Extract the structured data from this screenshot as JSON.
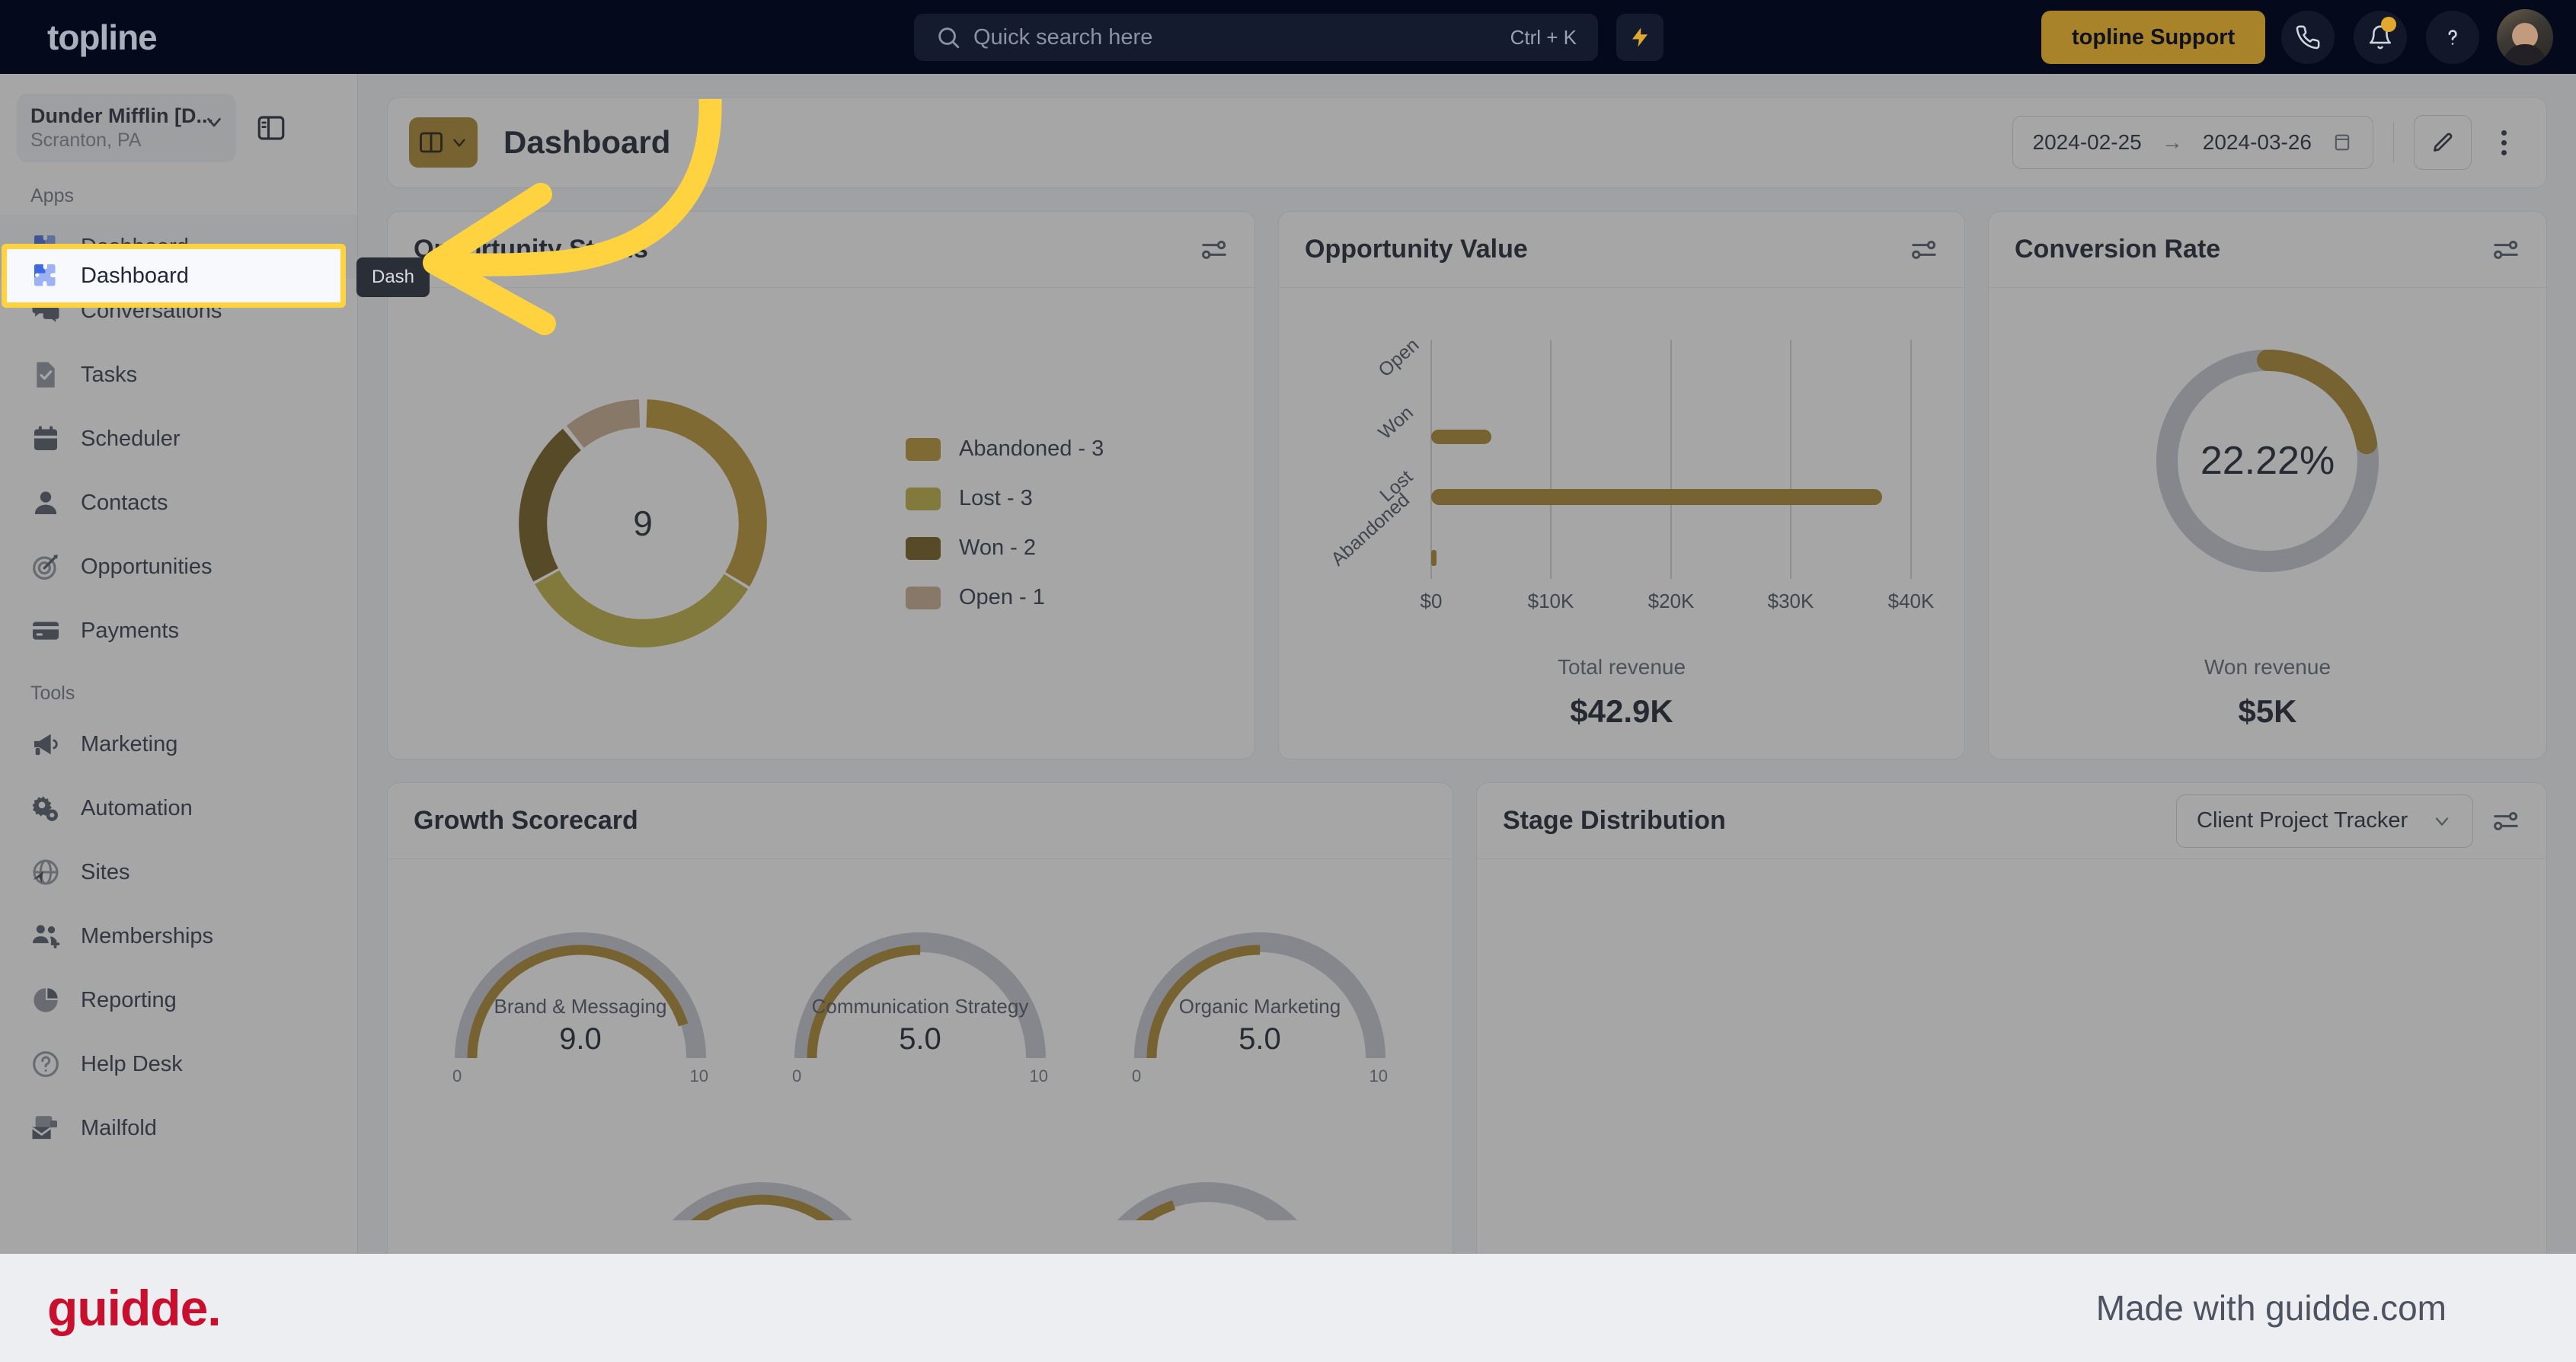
{
  "topbar": {
    "logo": "topline",
    "search": {
      "placeholder": "Quick search here",
      "value": "",
      "shortcut": "Ctrl + K",
      "icon": "search-icon"
    },
    "bolt_icon": "lightning-bolt-icon",
    "support_button": "topline Support",
    "phone_icon": "phone-icon",
    "bell_icon": "bell-icon",
    "help_icon": "question-mark-icon",
    "avatar": "user-avatar"
  },
  "sidebar": {
    "org": {
      "name": "Dunder Mifflin [D...",
      "location": "Scranton, PA",
      "chevron": "chevron-down-icon"
    },
    "panel_toggle_icon": "panel-collapse-icon",
    "sections": [
      {
        "label": "Apps",
        "items": [
          {
            "label": "Dashboard",
            "icon": "puzzle-icon",
            "active": true
          },
          {
            "label": "Conversations",
            "icon": "chat-bubbles-icon",
            "active": false
          },
          {
            "label": "Tasks",
            "icon": "task-check-icon",
            "active": false
          },
          {
            "label": "Scheduler",
            "icon": "calendar-icon",
            "active": false
          },
          {
            "label": "Contacts",
            "icon": "person-icon",
            "active": false
          },
          {
            "label": "Opportunities",
            "icon": "target-icon",
            "active": false
          },
          {
            "label": "Payments",
            "icon": "credit-card-icon",
            "active": false
          }
        ]
      },
      {
        "label": "Tools",
        "items": [
          {
            "label": "Marketing",
            "icon": "megaphone-icon",
            "active": false
          },
          {
            "label": "Automation",
            "icon": "gears-icon",
            "active": false
          },
          {
            "label": "Sites",
            "icon": "globe-cursor-icon",
            "active": false
          },
          {
            "label": "Memberships",
            "icon": "people-plus-icon",
            "active": false
          },
          {
            "label": "Reporting",
            "icon": "pie-chart-icon",
            "active": false
          },
          {
            "label": "Help Desk",
            "icon": "question-circle-icon",
            "active": false
          },
          {
            "label": "Mailfold",
            "icon": "mail-stack-icon",
            "active": false
          }
        ]
      }
    ],
    "tooltip": "Dash",
    "bottom_bell_icon": "notification-bell-icon",
    "bottom_fab_icon": "guidde-logo-icon"
  },
  "header": {
    "layout_button_icon": "layout-panel-icon",
    "layout_chevron": "chevron-down-icon",
    "title": "Dashboard",
    "date_start": "2024-02-25",
    "date_arrow": "→",
    "date_end": "2024-03-26",
    "calendar_icon": "calendar-icon",
    "edit_icon": "pencil-icon",
    "more_icon": "three-dot-menu-icon"
  },
  "cards": {
    "opportunity_status": {
      "title": "Opportunity Status",
      "settings_icon": "sliders-icon"
    },
    "opportunity_value": {
      "title": "Opportunity Value",
      "settings_icon": "sliders-icon"
    },
    "conversion_rate": {
      "title": "Conversion Rate",
      "settings_icon": "sliders-icon"
    },
    "growth_scorecard": {
      "title": "Growth Scorecard"
    },
    "stage_distribution": {
      "title": "Stage Distribution",
      "selected_pipeline": "Client Project Tracker",
      "chevron": "chevron-down-icon",
      "settings_icon": "sliders-icon"
    }
  },
  "colors": {
    "brand_gold": "#a8832a",
    "abandoned": "#b8912e",
    "lost": "#bdae3e",
    "won": "#6e5614",
    "open": "#c7ab8c",
    "track_gray": "#c2c6d0",
    "topbar_navy": "#04091c",
    "highlight_yellow": "#ffd23f",
    "guidde_red": "#c8102e"
  },
  "chart_data": [
    {
      "type": "pie",
      "title": "Opportunity Status",
      "center_label": "9",
      "total": 9,
      "categories": [
        "Abandoned",
        "Lost",
        "Won",
        "Open"
      ],
      "values": [
        3,
        3,
        2,
        1
      ],
      "colors": [
        "#b8912e",
        "#bdae3e",
        "#6e5614",
        "#c7ab8c"
      ],
      "legend": [
        "Abandoned - 3",
        "Lost - 3",
        "Won - 2",
        "Open - 1"
      ],
      "legend_position": "right",
      "donut": true
    },
    {
      "type": "bar",
      "orientation": "horizontal",
      "title": "Opportunity Value",
      "categories": [
        "Open",
        "Won",
        "Lost",
        "Abandoned"
      ],
      "values": [
        0,
        5000,
        37500,
        400
      ],
      "xlabel": "",
      "ylabel": "",
      "xlim": [
        0,
        43000
      ],
      "xticks": [
        0,
        10000,
        20000,
        30000,
        40000
      ],
      "xtick_labels": [
        "$0",
        "$10K",
        "$20K",
        "$30K",
        "$40K"
      ],
      "grid": true,
      "bar_color": "#a8832a",
      "footer_label": "Total revenue",
      "footer_value": "$42.9K"
    },
    {
      "type": "pie",
      "subtype": "gauge-ring",
      "title": "Conversion Rate",
      "center_label": "22.22%",
      "values": [
        22.22,
        77.78
      ],
      "colors": [
        "#a8832a",
        "#c2c6d0"
      ],
      "footer_label": "Won revenue",
      "footer_value": "$5K"
    },
    {
      "type": "bar",
      "subtype": "gauges",
      "title": "Growth Scorecard",
      "ylim": [
        0,
        10
      ],
      "gauges": [
        {
          "label": "Brand & Messaging",
          "value": "9.0",
          "numeric": 9.0,
          "min": "0",
          "max": "10"
        },
        {
          "label": "Communication Strategy",
          "value": "5.0",
          "numeric": 5.0,
          "min": "0",
          "max": "10"
        },
        {
          "label": "Organic Marketing",
          "value": "5.0",
          "numeric": 5.0,
          "min": "0",
          "max": "10"
        }
      ]
    }
  ],
  "footer": {
    "logo": "guidde.",
    "made_with": "Made with guidde.com"
  }
}
